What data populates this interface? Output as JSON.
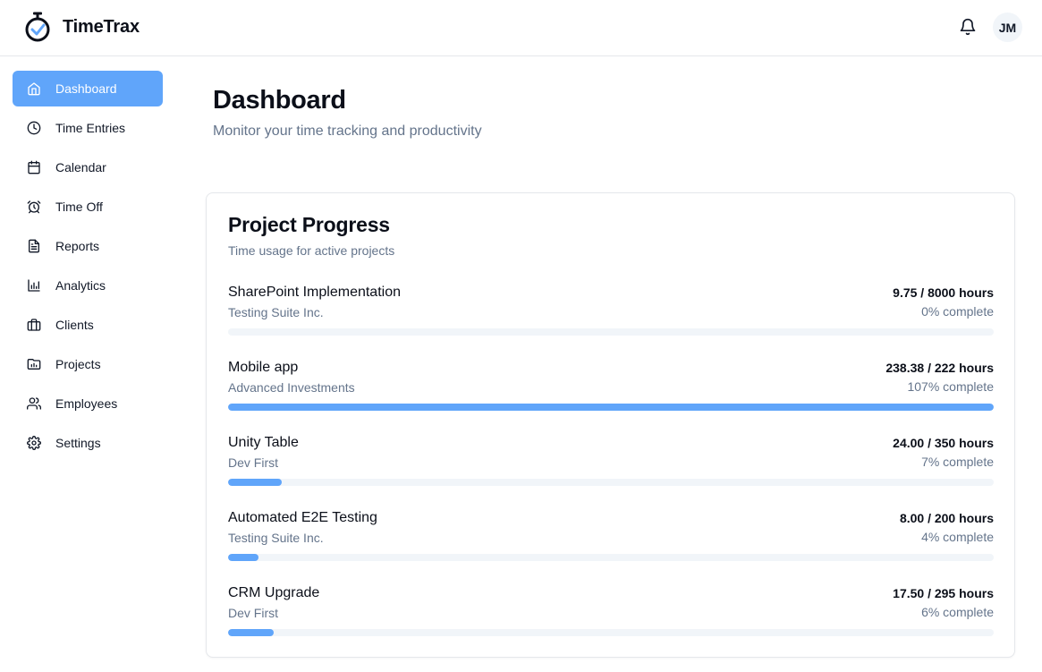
{
  "app": {
    "name": "TimeTrax"
  },
  "header": {
    "avatar_initials": "JM",
    "bell_icon": "bell-icon"
  },
  "sidebar": {
    "items": [
      {
        "label": "Dashboard",
        "icon": "home-icon",
        "active": true
      },
      {
        "label": "Time Entries",
        "icon": "clock-icon",
        "active": false
      },
      {
        "label": "Calendar",
        "icon": "calendar-icon",
        "active": false
      },
      {
        "label": "Time Off",
        "icon": "alarm-clock-icon",
        "active": false
      },
      {
        "label": "Reports",
        "icon": "file-text-icon",
        "active": false
      },
      {
        "label": "Analytics",
        "icon": "bar-chart-icon",
        "active": false
      },
      {
        "label": "Clients",
        "icon": "briefcase-icon",
        "active": false
      },
      {
        "label": "Projects",
        "icon": "folder-chart-icon",
        "active": false
      },
      {
        "label": "Employees",
        "icon": "users-icon",
        "active": false
      },
      {
        "label": "Settings",
        "icon": "gear-icon",
        "active": false
      }
    ]
  },
  "main": {
    "title": "Dashboard",
    "subtitle": "Monitor your time tracking and productivity"
  },
  "project_progress": {
    "title": "Project Progress",
    "subtitle": "Time usage for active projects",
    "projects": [
      {
        "name": "SharePoint Implementation",
        "client": "Testing Suite Inc.",
        "hours": "9.75 / 8000 hours",
        "percent_text": "0% complete",
        "progress": 0
      },
      {
        "name": "Mobile app",
        "client": "Advanced Investments",
        "hours": "238.38 / 222 hours",
        "percent_text": "107% complete",
        "progress": 100
      },
      {
        "name": "Unity Table",
        "client": "Dev First",
        "hours": "24.00 / 350 hours",
        "percent_text": "7% complete",
        "progress": 7
      },
      {
        "name": "Automated E2E Testing",
        "client": "Testing Suite Inc.",
        "hours": "8.00 / 200 hours",
        "percent_text": "4% complete",
        "progress": 4
      },
      {
        "name": "CRM Upgrade",
        "client": "Dev First",
        "hours": "17.50 / 295 hours",
        "percent_text": "6% complete",
        "progress": 6
      }
    ]
  },
  "colors": {
    "accent": "#60a5fa",
    "track": "#f1f5f9",
    "muted_text": "#64748b"
  }
}
